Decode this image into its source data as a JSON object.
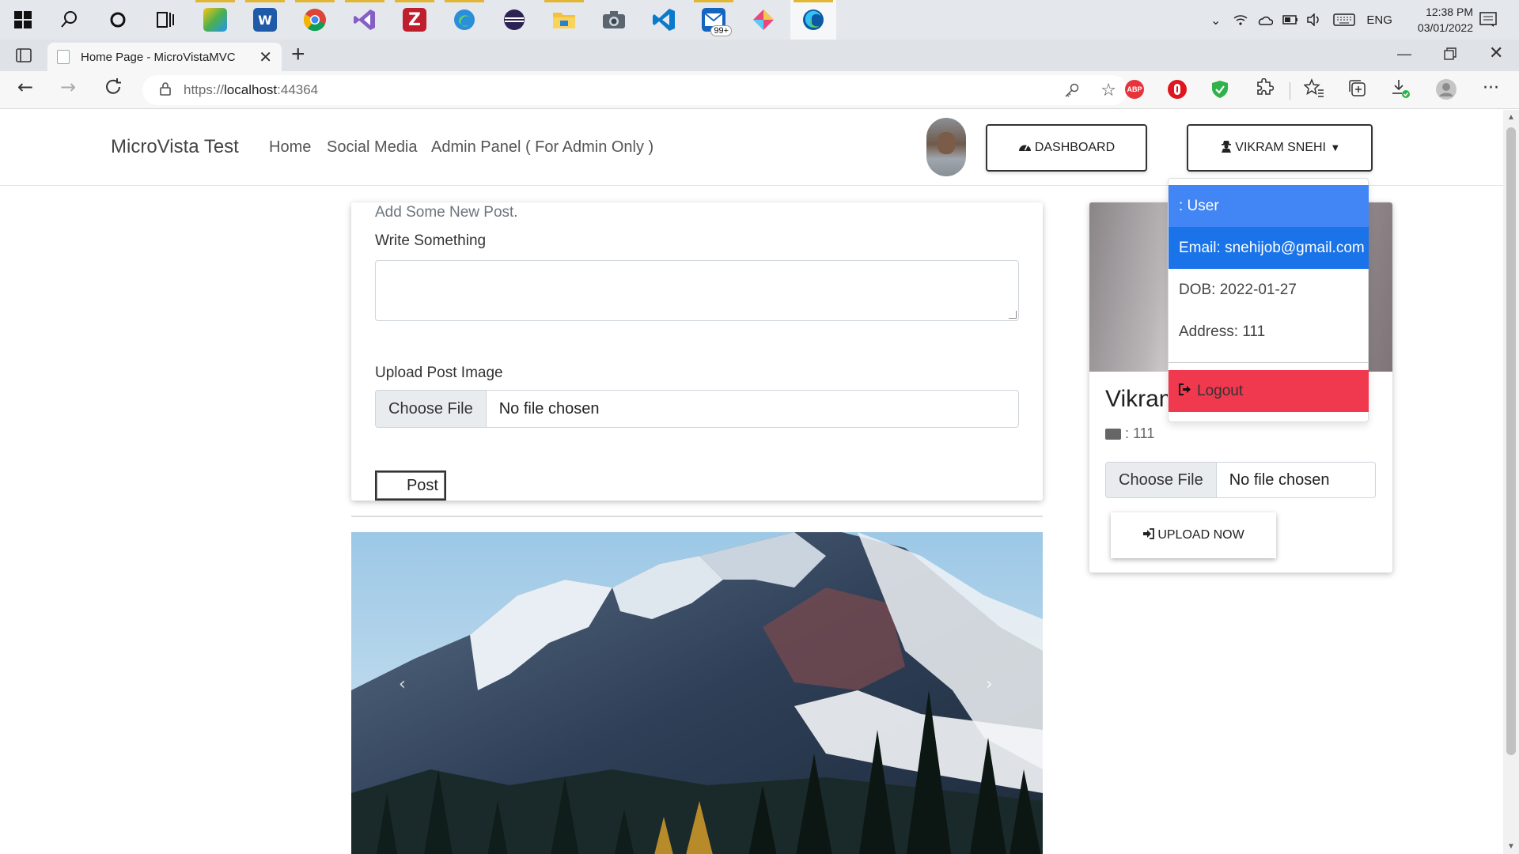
{
  "taskbar": {
    "apps": [
      {
        "name": "start-icon"
      },
      {
        "name": "search-icon"
      },
      {
        "name": "cortana-icon"
      },
      {
        "name": "task-view-icon"
      },
      {
        "name": "visual-studio-installer-icon"
      },
      {
        "name": "word-icon",
        "glyph": "W"
      },
      {
        "name": "chrome-icon"
      },
      {
        "name": "visual-studio-icon"
      },
      {
        "name": "filezilla-icon",
        "glyph": "Z"
      },
      {
        "name": "edge-beta-icon"
      },
      {
        "name": "eclipse-icon"
      },
      {
        "name": "file-explorer-icon"
      },
      {
        "name": "camera-icon"
      },
      {
        "name": "vscode-icon"
      },
      {
        "name": "mail-icon",
        "badge": "99+"
      },
      {
        "name": "sourcetree-icon"
      },
      {
        "name": "edge-icon"
      }
    ],
    "tray_language": "ENG",
    "clock_time": "12:38 PM",
    "clock_date": "03/01/2022"
  },
  "browser": {
    "tab_title": "Home Page - MicroVistaMVC",
    "url_prefix": "https://",
    "url_host": "localhost",
    "url_port": ":44364",
    "extensions": [
      {
        "name": "adblock-plus-icon",
        "label": "ABP",
        "color": "#e5343c"
      },
      {
        "name": "opera-addon-icon",
        "label": "",
        "color": "#e0161e"
      },
      {
        "name": "shield-extension-icon",
        "label": "",
        "color": "#2fb24a"
      }
    ]
  },
  "site": {
    "brand": "MicroVista Test",
    "nav": [
      "Home",
      "Social Media",
      "Admin Panel ( For Admin Only )"
    ],
    "dashboard_label": "DASHBOARD",
    "user_menu_label": "VIKRAM SNEHI"
  },
  "post_form": {
    "heading": "Add Some New Post.",
    "write_label": "Write Something",
    "write_value": "",
    "upload_label": "Upload Post Image",
    "choose_file": "Choose File",
    "no_file": "No file chosen",
    "post_button": "Post"
  },
  "profile": {
    "name": "Vikram Snehi",
    "address_text": ": 111",
    "choose_file": "Choose File",
    "no_file": "No file chosen",
    "upload_button": "UPLOAD NOW"
  },
  "dropdown": {
    "items": [
      {
        "label": ": User",
        "bg": "#4285f4"
      },
      {
        "label": "Email: snehijob@gmail.com",
        "bg": "#1a73e8"
      },
      {
        "label": "DOB: 2022-01-27",
        "bg": ""
      },
      {
        "label": "Address: 111",
        "bg": ""
      }
    ],
    "logout_label": "Logout",
    "logout_bg": "#f0384f"
  },
  "carousel": {
    "prev": "‹",
    "next": "›"
  },
  "colors": {
    "accent_blue": "#1a73e8",
    "danger_red": "#f0384f"
  }
}
